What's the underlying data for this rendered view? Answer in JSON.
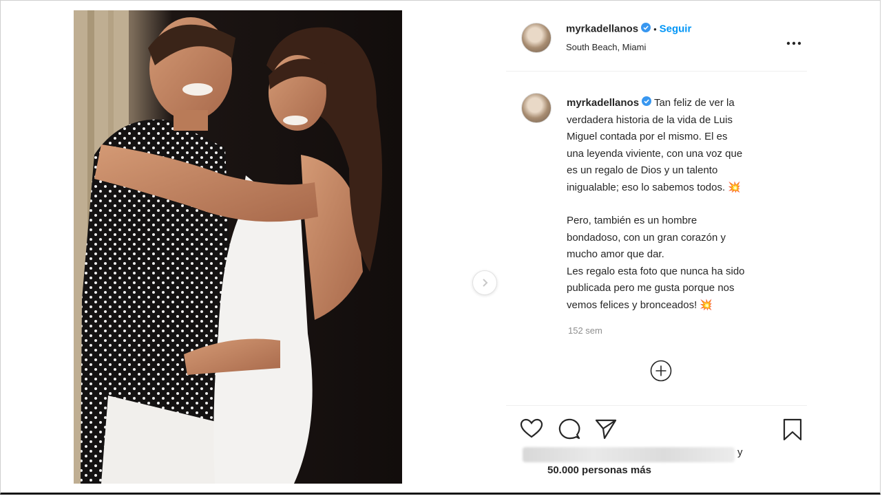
{
  "post": {
    "username": "myrkadellanos",
    "follow_label": "Seguir",
    "location": "South Beach, Miami",
    "caption_lines": [
      "Tan feliz de ver la",
      "verdadera historia de la vida de Luis",
      "Miguel contada por el mismo. El es",
      "una leyenda viviente, con una voz que",
      "es un regalo de Dios y un talento",
      "inigualable; eso lo sabemos todos. 💥"
    ],
    "caption_lines_2": [
      "Pero, también es un hombre",
      "bondadoso, con un gran corazón y",
      "mucho amor que dar.",
      "Les regalo esta foto que nunca ha sido",
      "publicada pero me gusta porque nos",
      "vemos felices y bronceados! 💥"
    ],
    "timestamp": "152 sem",
    "likes_suffix": "y",
    "likes_more": "50.000 personas más"
  },
  "icons": {
    "verified": "verified-badge-icon",
    "more": "more-options-icon",
    "next": "chevron-right-icon",
    "load_more": "plus-circle-icon",
    "like": "heart-icon",
    "comment": "comment-icon",
    "share": "paper-plane-icon",
    "save": "bookmark-icon"
  },
  "colors": {
    "accent": "#0095f6",
    "text": "#262626",
    "muted": "#8e8e8e"
  }
}
